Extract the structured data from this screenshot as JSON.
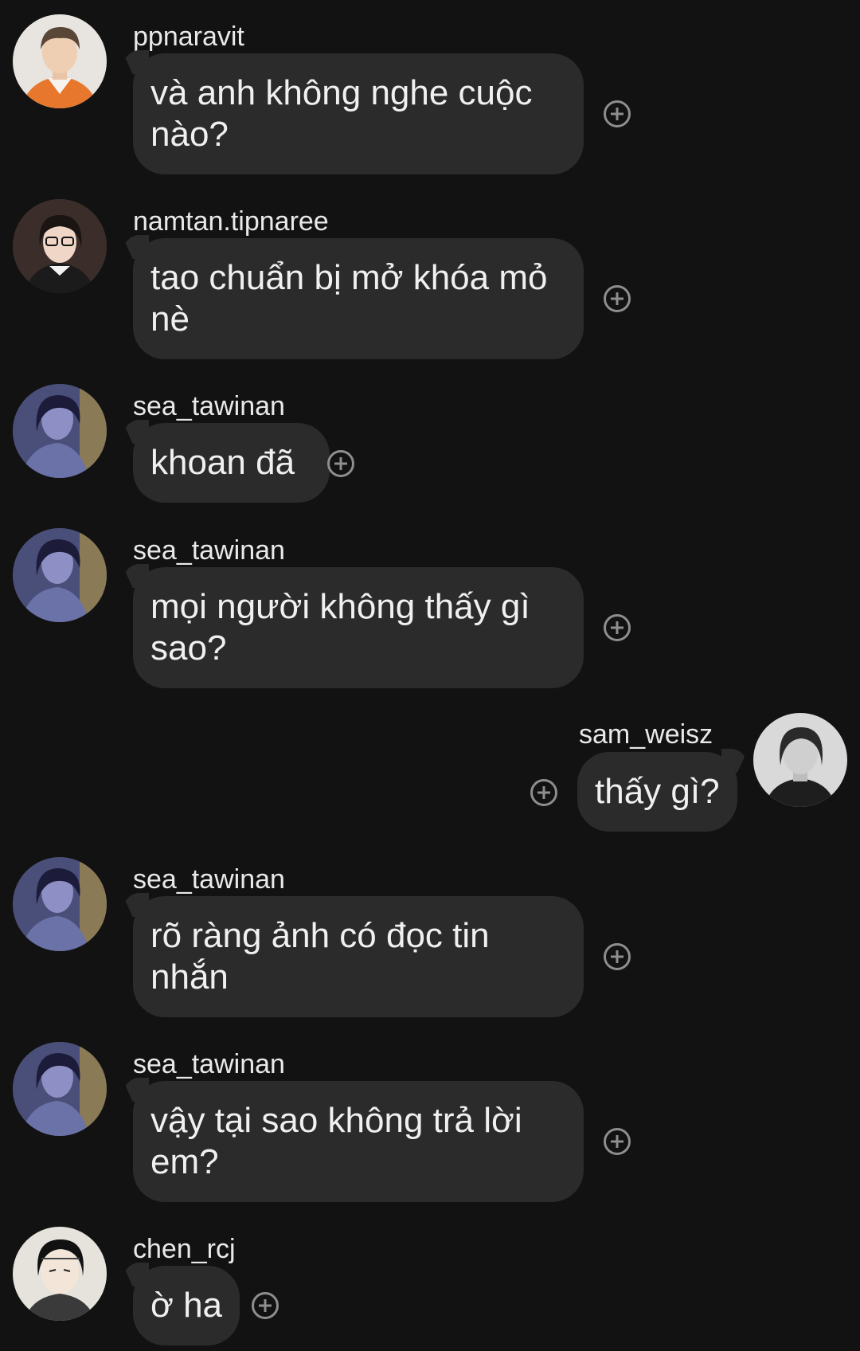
{
  "messages": [
    {
      "user": "ppnaravit",
      "text": "và anh không nghe cuộc nào?",
      "side": "left",
      "avatar_icon": "avatar-ppnaravit"
    },
    {
      "user": "namtan.tipnaree",
      "text": "tao chuẩn bị mở khóa mỏ nè",
      "side": "left",
      "avatar_icon": "avatar-namtan"
    },
    {
      "user": "sea_tawinan",
      "text": "khoan đã",
      "side": "left",
      "avatar_icon": "avatar-sea"
    },
    {
      "user": "sea_tawinan",
      "text": "mọi người không thấy gì sao?",
      "side": "left",
      "avatar_icon": "avatar-sea"
    },
    {
      "user": "sam_weisz",
      "text": "thấy gì?",
      "side": "right",
      "avatar_icon": "avatar-sam"
    },
    {
      "user": "sea_tawinan",
      "text": "rõ ràng ảnh có đọc tin nhắn",
      "side": "left",
      "avatar_icon": "avatar-sea"
    },
    {
      "user": "sea_tawinan",
      "text": "vậy tại sao không trả lời em?",
      "side": "left",
      "avatar_icon": "avatar-sea"
    },
    {
      "user": "chen_rcj",
      "text": "ờ ha",
      "side": "left",
      "avatar_icon": "avatar-chen"
    }
  ],
  "icons": {
    "react": "add-reaction-icon"
  },
  "colors": {
    "background": "#121212",
    "bubble": "#2b2b2b",
    "text": "#f0f0f0",
    "icon": "#8e8e8e"
  }
}
